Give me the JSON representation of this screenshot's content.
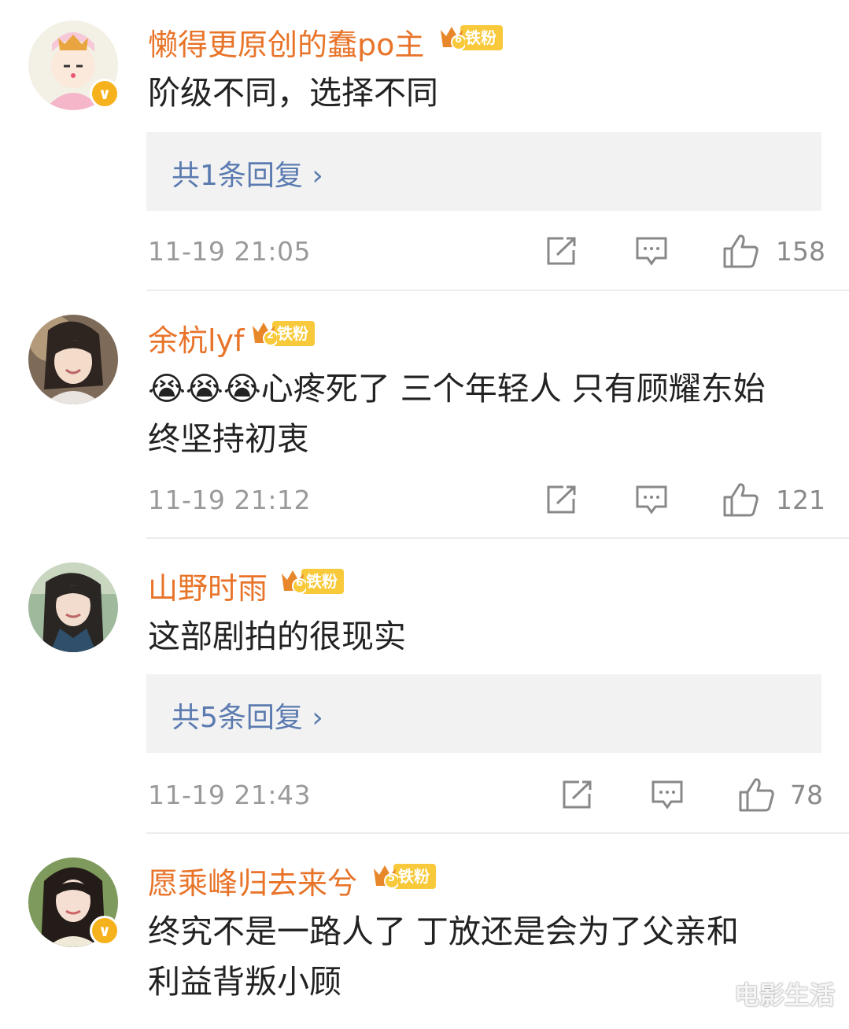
{
  "comments": [
    {
      "username": "懒得更原创的蠢po主",
      "fan_level": "6",
      "fan_label": "铁粉",
      "verified": true,
      "text_lines": [
        "阶级不同，选择不同"
      ],
      "reply_label": "共1条回复 ›",
      "time": "11-19 21:05",
      "likes": "158"
    },
    {
      "username": "余杭lyf",
      "fan_level": "2",
      "fan_label": "铁粉",
      "verified": false,
      "text_lines": [
        "😭😭😭心疼死了 三个年轻人 只有顾耀东始",
        "终坚持初衷"
      ],
      "reply_label": "",
      "time": "11-19 21:12",
      "likes": "121"
    },
    {
      "username": "山野时雨",
      "fan_level": "6",
      "fan_label": "铁粉",
      "verified": false,
      "text_lines": [
        "这部剧拍的很现实"
      ],
      "reply_label": "共5条回复 ›",
      "time": "11-19 21:43",
      "likes": "78"
    },
    {
      "username": "愿乘峰归去来兮",
      "fan_level": "5",
      "fan_label": "铁粉",
      "verified": true,
      "text_lines": [
        "终究不是一路人了 丁放还是会为了父亲和",
        "利益背叛小顾"
      ],
      "reply_label": "",
      "time": "",
      "likes": ""
    }
  ],
  "watermark": "电影生活",
  "colors": {
    "username": "#e8742a",
    "reply_link": "#5b7bb0",
    "badge_gold": "#f8c93a"
  },
  "icons": [
    "share-icon",
    "comment-icon",
    "like-icon"
  ]
}
